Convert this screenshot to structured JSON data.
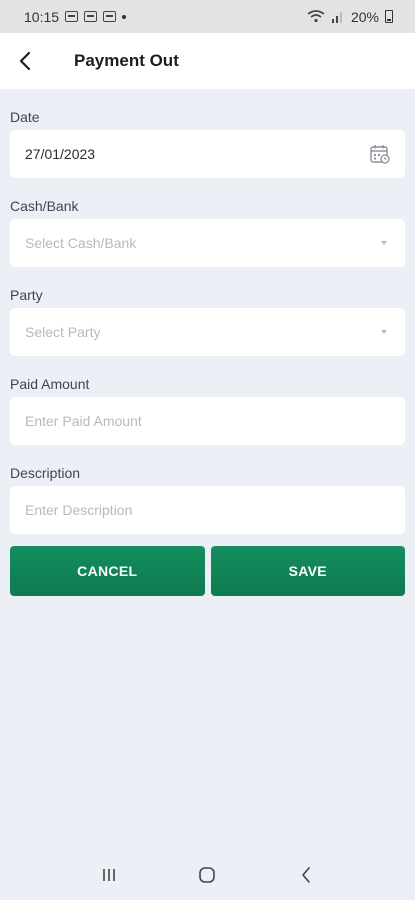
{
  "status_bar": {
    "time": "10:15",
    "battery": "20%"
  },
  "header": {
    "title": "Payment Out",
    "back_icon": "arrow-left-icon"
  },
  "form": {
    "date": {
      "label": "Date",
      "value": "27/01/2023",
      "icon": "calendar-icon"
    },
    "cash_bank": {
      "label": "Cash/Bank",
      "placeholder": "Select Cash/Bank"
    },
    "party": {
      "label": "Party",
      "placeholder": "Select Party"
    },
    "paid_amount": {
      "label": "Paid Amount",
      "placeholder": "Enter Paid Amount"
    },
    "description": {
      "label": "Description",
      "placeholder": "Enter Description"
    }
  },
  "actions": {
    "cancel_label": "CANCEL",
    "save_label": "SAVE"
  },
  "colors": {
    "accent": "#0f7f52",
    "background": "#ecf0f6",
    "field_bg": "#ffffff"
  },
  "nav_bar": {
    "recents_icon": "recents-icon",
    "home_icon": "home-icon",
    "back_icon": "nav-back-icon"
  }
}
